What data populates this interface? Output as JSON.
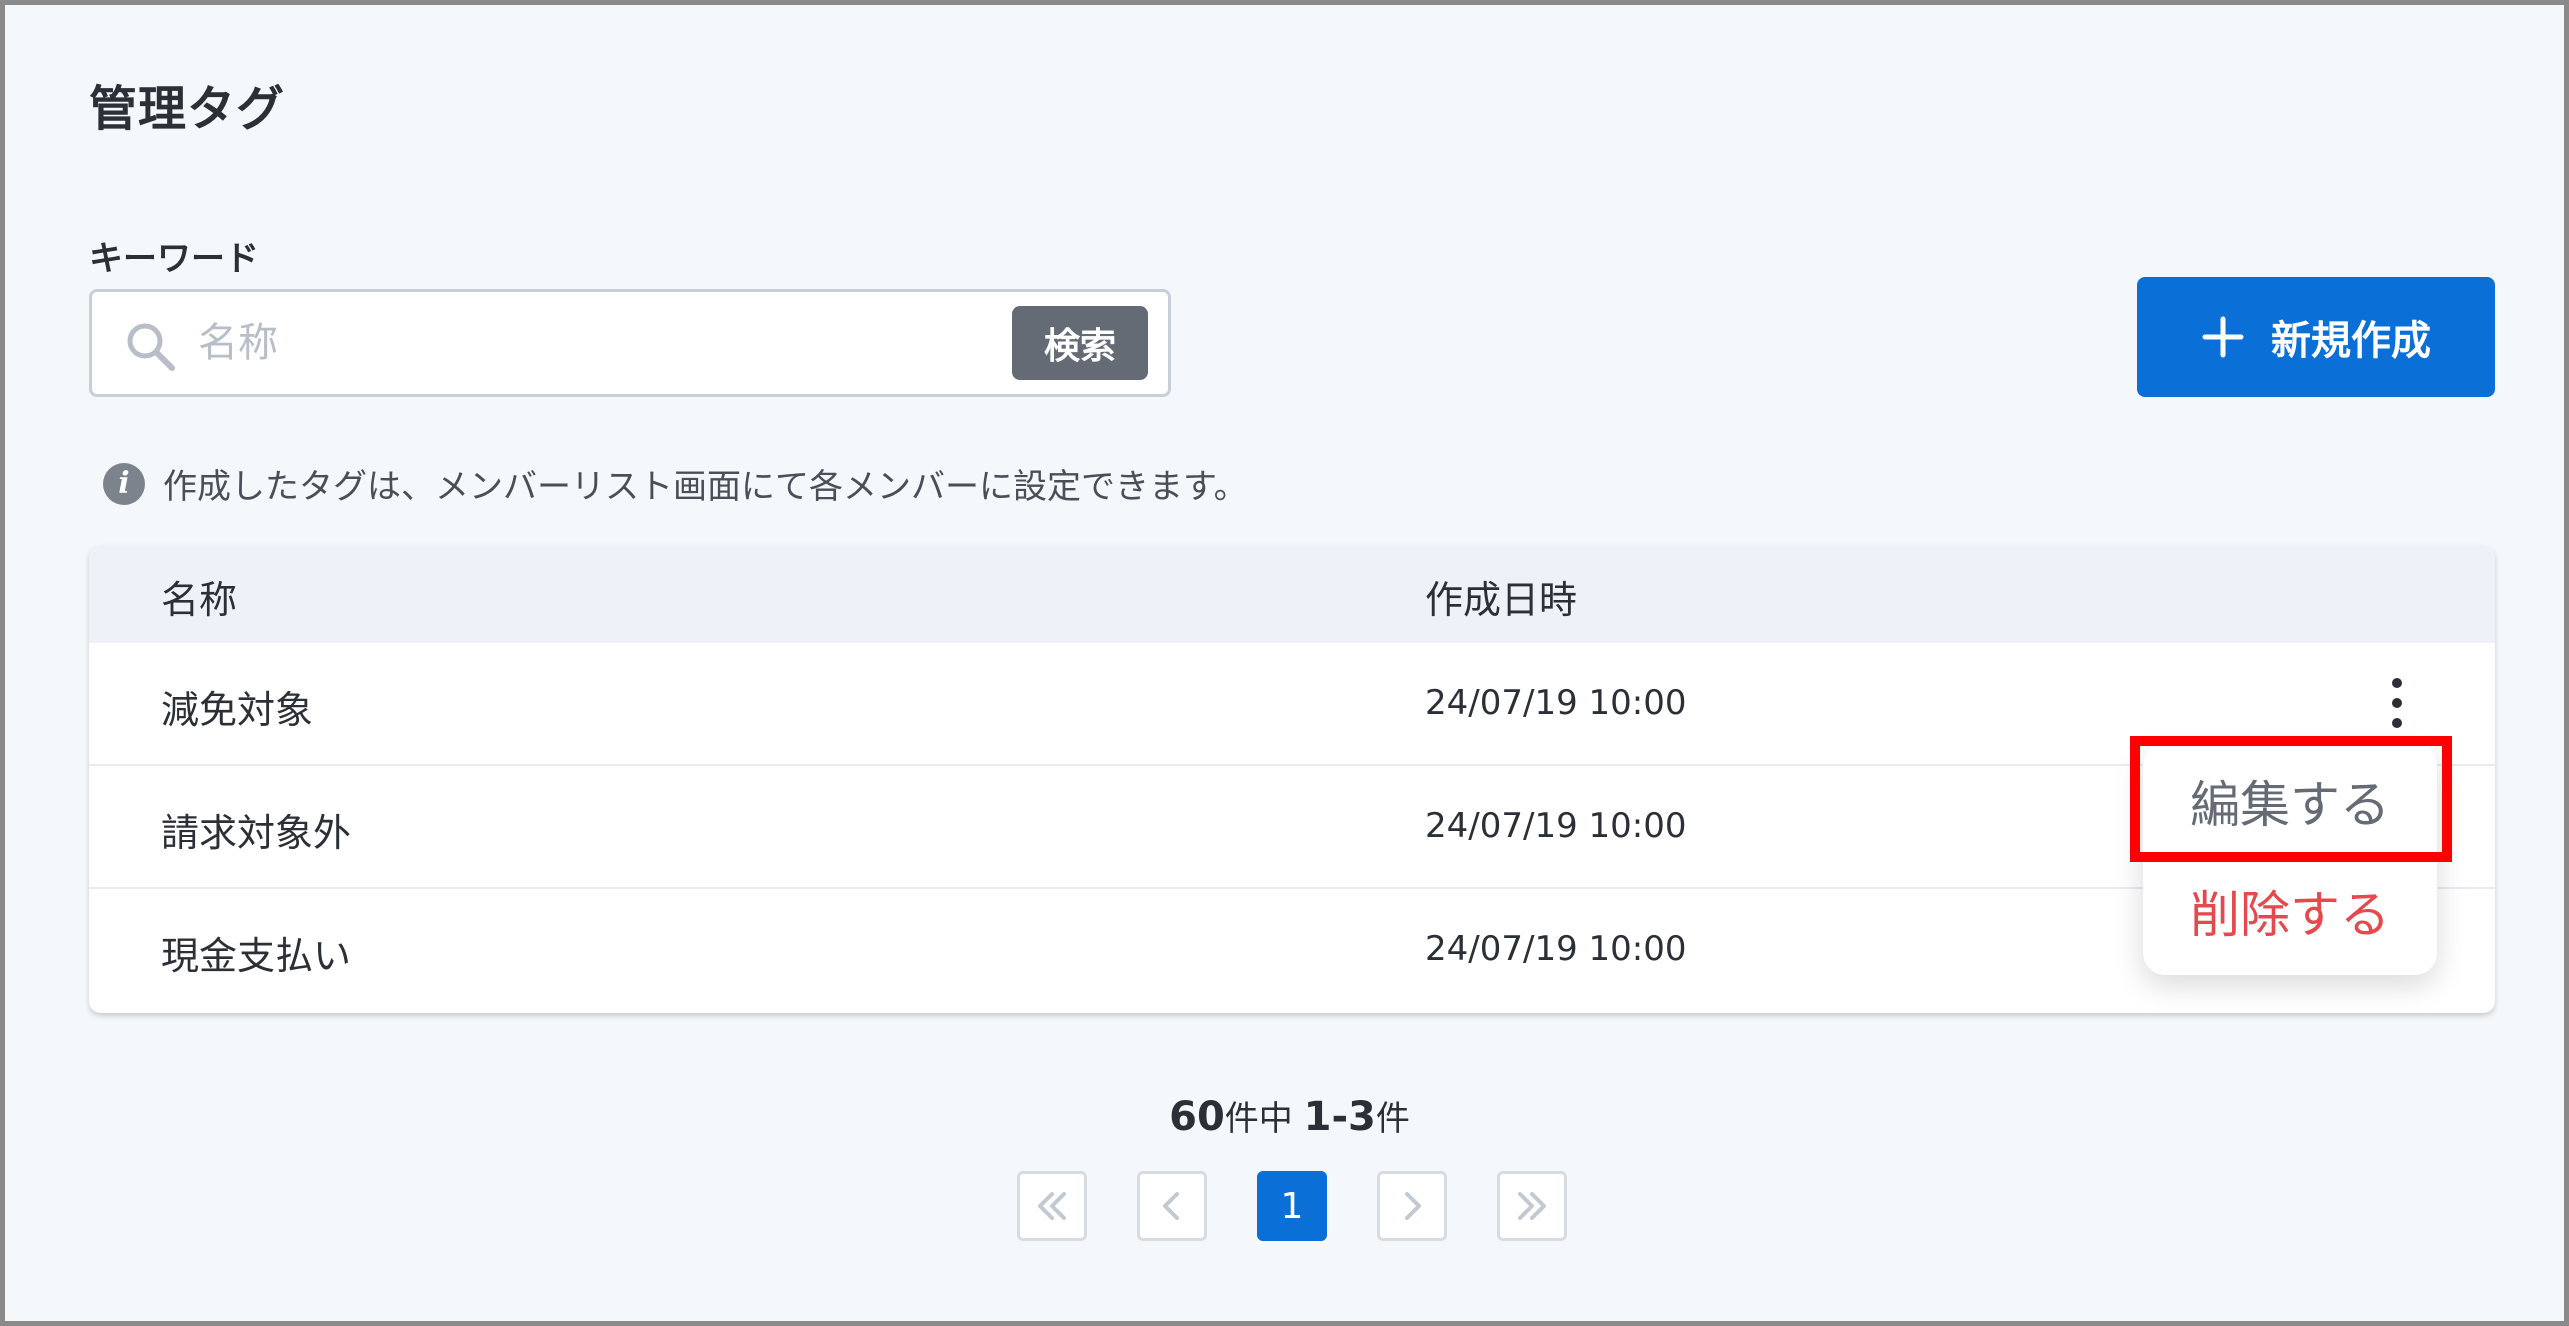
{
  "page": {
    "title": "管理タグ"
  },
  "search": {
    "label": "キーワード",
    "placeholder": "名称",
    "value": "",
    "button_label": "検索"
  },
  "new_button": {
    "label": "新規作成"
  },
  "info": {
    "text": "作成したタグは、メンバーリスト画面にて各メンバーに設定できます。"
  },
  "table": {
    "headers": {
      "name": "名称",
      "created_at": "作成日時"
    },
    "rows": [
      {
        "name": "減免対象",
        "created_at": "24/07/19 10:00"
      },
      {
        "name": "請求対象外",
        "created_at": "24/07/19 10:00"
      },
      {
        "name": "現金支払い",
        "created_at": "24/07/19 10:00"
      }
    ]
  },
  "row_menu": {
    "edit_label": "編集する",
    "delete_label": "削除する"
  },
  "pagination": {
    "total": "60",
    "total_suffix": "件中",
    "range": "1-3",
    "range_suffix": "件",
    "current_page": "1"
  },
  "colors": {
    "primary": "#0a6fd7",
    "search_button": "#646b75",
    "delete": "#e5484d",
    "highlight": "#ff0000"
  },
  "icons": {
    "search": "search-icon",
    "plus": "plus-icon",
    "info": "info-icon",
    "more": "kebab-icon",
    "first": "double-chevron-left-icon",
    "prev": "chevron-left-icon",
    "next": "chevron-right-icon",
    "last": "double-chevron-right-icon"
  }
}
